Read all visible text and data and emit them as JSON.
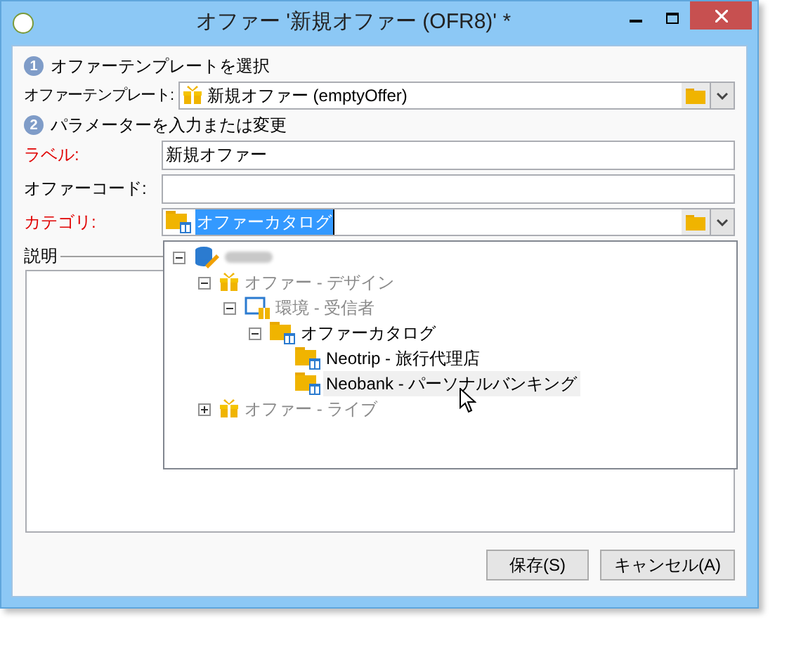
{
  "window": {
    "title": "オファー '新規オファー (OFR8)' *"
  },
  "steps": [
    {
      "number": "1",
      "label": "オファーテンプレートを選択"
    },
    {
      "number": "2",
      "label": "パラメーターを入力または変更"
    }
  ],
  "template": {
    "label": "オファーテンプレート:",
    "value": "新規オファー (emptyOffer)"
  },
  "fields": [
    {
      "label": "ラベル:",
      "required": true,
      "value": "新規オファー"
    },
    {
      "label": "オファーコード:",
      "required": false
    }
  ],
  "category": {
    "label": "カテゴリ:",
    "required": true,
    "value": "オファーカタログ"
  },
  "description": {
    "label": "説明"
  },
  "tree": [
    {
      "kind": "database",
      "expanded": true,
      "disabled": true,
      "hovered": false,
      "children": [
        {
          "kind": "gift",
          "label": "オファー - デザイン",
          "expanded": true,
          "disabled": true,
          "hovered": false,
          "children": [
            {
              "kind": "environment",
              "label": "環境 - 受信者",
              "expanded": true,
              "disabled": true,
              "hovered": false,
              "children": [
                {
                  "kind": "folder",
                  "label": "オファーカタログ",
                  "expanded": true,
                  "disabled": false,
                  "hovered": false,
                  "children": [
                    {
                      "kind": "folder",
                      "label": "Neotrip - 旅行代理店",
                      "disabled": false,
                      "hovered": false
                    },
                    {
                      "kind": "folder",
                      "label": "Neobank - パーソナルバンキング",
                      "disabled": false,
                      "hovered": true
                    }
                  ]
                }
              ]
            }
          ]
        },
        {
          "kind": "gift",
          "label": "オファー - ライブ",
          "expanded": false,
          "disabled": true,
          "hovered": false
        }
      ]
    }
  ],
  "buttons": [
    "保存(S)",
    "キャンセル(A)"
  ]
}
